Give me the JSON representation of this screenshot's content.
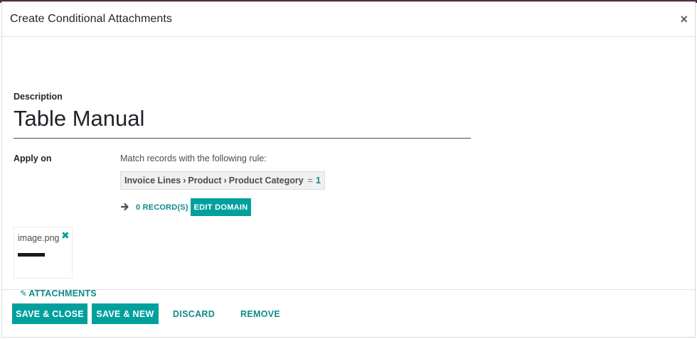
{
  "dialog": {
    "title": "Create Conditional Attachments",
    "close_label": "×"
  },
  "form": {
    "description_label": "Description",
    "description_value": "Table Manual",
    "apply_on_label": "Apply on",
    "rule_text": "Match records with the following rule:",
    "domain": {
      "path": [
        "Invoice Lines",
        "Product",
        "Product Category"
      ],
      "path_separator": "›",
      "operator": "=",
      "value": "1"
    },
    "records_link": "0 RECORD(S)",
    "edit_domain_label": "EDIT DOMAIN"
  },
  "attachments": {
    "files": [
      {
        "name": "image.png",
        "remove_icon": "close-icon"
      }
    ],
    "button_label": "ATTACHMENTS",
    "button_icon": "paperclip-icon"
  },
  "footer": {
    "save_close_label": "SAVE & CLOSE",
    "save_new_label": "SAVE & NEW",
    "discard_label": "DISCARD",
    "remove_label": "REMOVE"
  },
  "colors": {
    "accent": "#00a09d",
    "link": "#0e8a8a",
    "topbar": "#4e2d45"
  }
}
